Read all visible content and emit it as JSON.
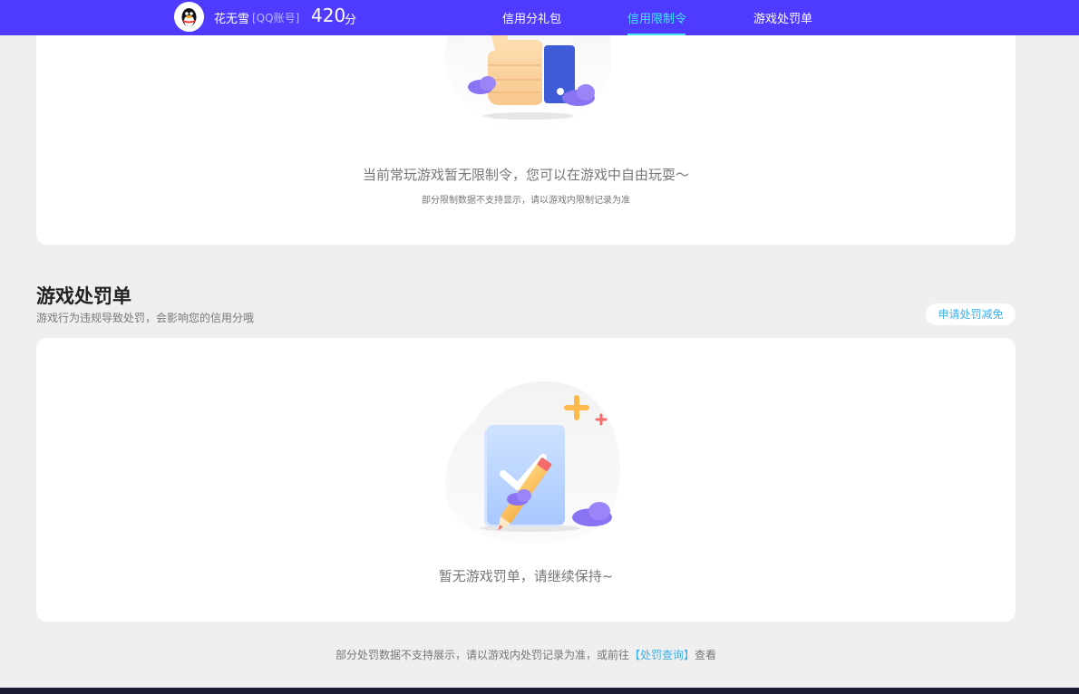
{
  "header": {
    "user_name": "花无雪",
    "account_type": "[QQ账号]",
    "score": "420",
    "score_unit": "分",
    "nav": [
      {
        "label": "信用分礼包",
        "active": false
      },
      {
        "label": "信用限制令",
        "active": true
      },
      {
        "label": "游戏处罚单",
        "active": false
      }
    ],
    "accent_color": "#4f3bff",
    "active_color": "#43e7ff"
  },
  "restriction_section": {
    "empty_message": "当前常玩游戏暂无限制令，您可以在游戏中自由玩耍～",
    "note": "部分限制数据不支持显示，请以游戏内限制记录为准",
    "illustration": "thumbs-up-illustration"
  },
  "penalty_section": {
    "title": "游戏处罚单",
    "subtitle": "游戏行为违规导致处罚，会影响您的信用分哦",
    "appeal_button": "申请处罚减免",
    "empty_message": "暂无游戏罚单，请继续保持~",
    "illustration": "checklist-pencil-illustration"
  },
  "footer": {
    "note_prefix": "部分处罚数据不支持展示，请以游戏内处罚记录为准，或前往",
    "link_text": "【处罚查询】",
    "note_suffix": "查看"
  }
}
